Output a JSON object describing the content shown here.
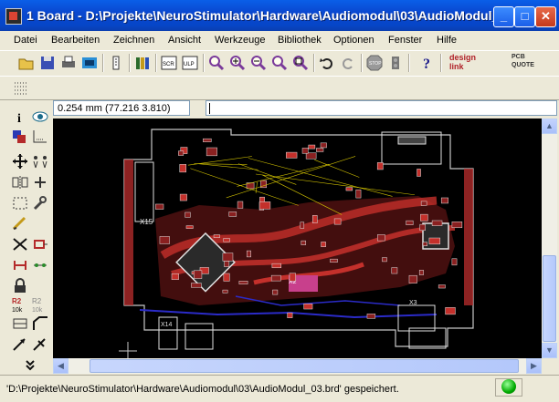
{
  "window": {
    "title": "1 Board - D:\\Projekte\\NeuroStimulator\\Hardware\\Audiomodul\\03\\AudioModul_...",
    "minimize_label": "_",
    "maximize_label": "□",
    "close_label": "✕"
  },
  "menu": [
    {
      "label": "Datei"
    },
    {
      "label": "Bearbeiten"
    },
    {
      "label": "Zeichnen"
    },
    {
      "label": "Ansicht"
    },
    {
      "label": "Werkzeuge"
    },
    {
      "label": "Bibliothek"
    },
    {
      "label": "Optionen"
    },
    {
      "label": "Fenster"
    },
    {
      "label": "Hilfe"
    }
  ],
  "toolbar": {
    "icons": [
      "open-icon",
      "save-icon",
      "print-icon",
      "cam-icon",
      "script-icon",
      "library-icon",
      "sch-icon",
      "ulp-icon",
      "zoom-fit-icon",
      "zoom-in-icon",
      "zoom-out-icon",
      "zoom-redraw-icon",
      "zoom-select-icon",
      "undo-icon",
      "redo-icon",
      "stop-icon",
      "go-icon",
      "help-icon"
    ],
    "designlink_label": "design link",
    "pcbquote_label": "PCB QUOTE"
  },
  "coord_readout": "0.254 mm (77.216 3.810)",
  "command_line": {
    "value": ""
  },
  "status": {
    "message": "'D:\\Projekte\\NeuroStimulator\\Hardware\\Audiomodul\\03\\AudioModul_03.brd' gespeichert.",
    "led_color": "#00aa00"
  },
  "colors": {
    "titlebar": "#0a48d0",
    "board_bg": "#000000",
    "outline": "#c8c8c8",
    "top_copper": "#c4302b",
    "bottom_copper": "#2b2bc8",
    "silkscreen": "#e0e0e0",
    "airwire": "#d4c400"
  },
  "board_labels": [
    "X2",
    "X3",
    "X15",
    "X14"
  ]
}
